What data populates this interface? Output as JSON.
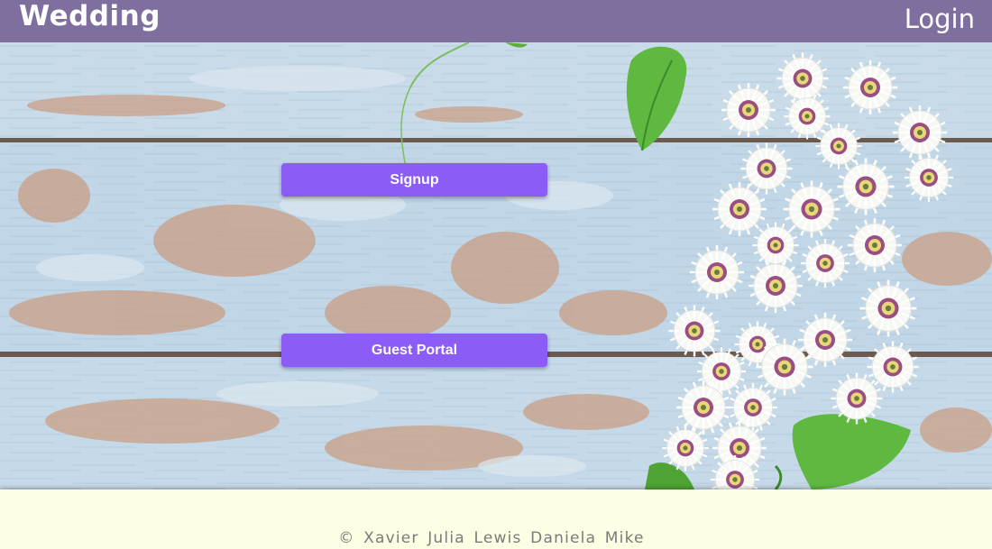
{
  "header": {
    "brand": "Wedding",
    "login_label": "Login",
    "background_color": "#7f6f9e"
  },
  "hero": {
    "signup_label": "Signup",
    "guest_portal_label": "Guest Portal",
    "button_color": "#8b5cf6"
  },
  "footer": {
    "copyright_symbol": "©",
    "credits": "Xavier Julia Lewis Daniela Mike",
    "background_color": "#fefee4"
  }
}
